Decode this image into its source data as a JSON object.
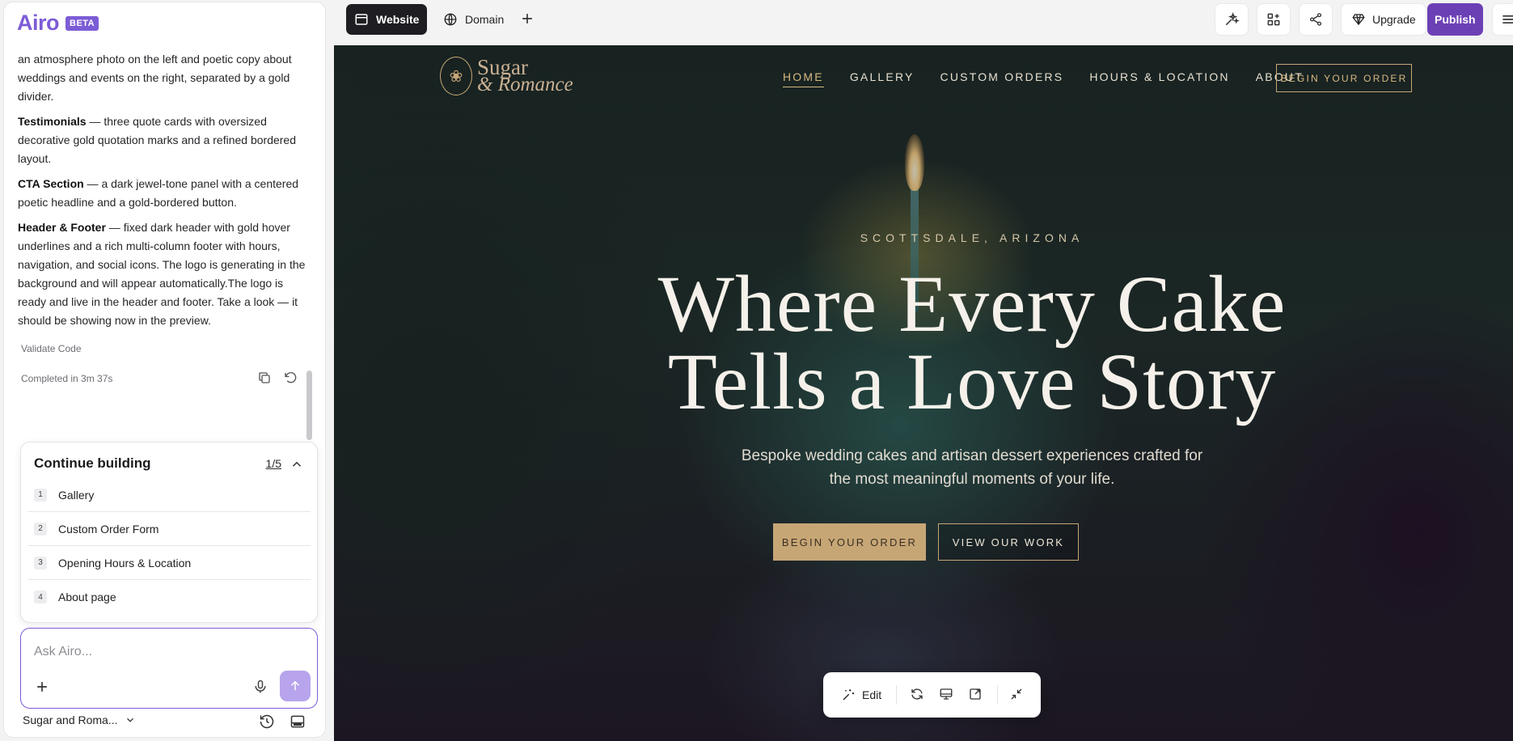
{
  "app": {
    "brand": "Airo",
    "badge": "BETA"
  },
  "chat": {
    "intro": "an atmosphere photo on the left and poetic copy about weddings and events on the right, separated by a gold divider.",
    "sections": [
      {
        "title": "Testimonials",
        "text": " — three quote cards with oversized decorative gold quotation marks and a refined bordered layout."
      },
      {
        "title": "CTA Section",
        "text": " — a dark jewel-tone panel with a centered poetic headline and a gold-bordered button."
      },
      {
        "title": "Header & Footer",
        "text": " — fixed dark header with gold hover underlines and a rich multi-column footer with hours, navigation, and social icons. The logo is generating in the background and will appear automatically.The logo is ready and live in the header and footer. Take a look — it should be showing now in the preview."
      }
    ],
    "validate": "Validate Code",
    "completed": "Completed in 3m 37s"
  },
  "continue_building": {
    "title": "Continue building",
    "count": "1/5",
    "items": [
      {
        "num": "1",
        "label": "Gallery"
      },
      {
        "num": "2",
        "label": "Custom Order Form"
      },
      {
        "num": "3",
        "label": "Opening Hours & Location"
      },
      {
        "num": "4",
        "label": "About page"
      }
    ]
  },
  "ask": {
    "placeholder": "Ask Airo..."
  },
  "project": {
    "name": "Sugar and Roma..."
  },
  "topbar": {
    "tab_website": "Website",
    "tab_domain": "Domain",
    "upgrade": "Upgrade",
    "publish": "Publish"
  },
  "site": {
    "logo_line1": "Sugar",
    "logo_line2": "& Romance",
    "nav": [
      "HOME",
      "GALLERY",
      "CUSTOM ORDERS",
      "HOURS & LOCATION",
      "ABOUT"
    ],
    "header_cta": "BEGIN YOUR ORDER",
    "eyebrow": "SCOTTSDALE, ARIZONA",
    "title_line1": "Where Every Cake",
    "title_line2": "Tells a Love Story",
    "subtitle": "Bespoke wedding cakes and artisan dessert experiences crafted for the most meaningful moments of your life.",
    "btn_primary": "BEGIN YOUR ORDER",
    "btn_secondary": "VIEW OUR WORK"
  },
  "preview_toolbar": {
    "edit": "Edit"
  },
  "colors": {
    "accent": "#7c5cd6",
    "publish": "#6c40b5",
    "gold": "#c7a676"
  }
}
